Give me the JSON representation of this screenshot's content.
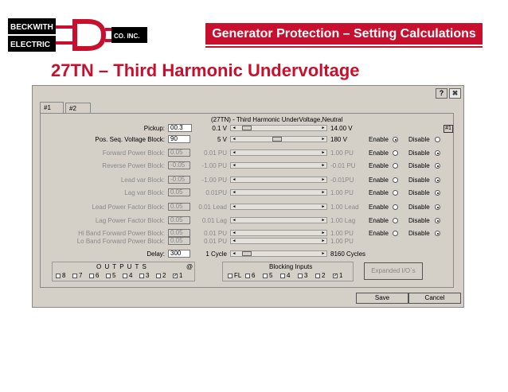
{
  "slide": {
    "logo": {
      "line1": "BECKWITH",
      "line2": "ELECTRIC",
      "suffix": "CO. INC."
    },
    "banner": "Generator Protection – Setting Calculations",
    "title": "27TN – Third Harmonic Undervoltage"
  },
  "window": {
    "help_label": "?",
    "close_label": "✖",
    "tabs": [
      "#1",
      "#2"
    ],
    "heading": "(27TN) - Third Harmonic UnderVoltage,Neutral",
    "badge": "#1",
    "enable_label": "Enable",
    "disable_label": "Disable",
    "rows": [
      {
        "label": "Pickup:",
        "value": "00.3",
        "min": "0.1 V",
        "max": "14.00 V",
        "enabled": true,
        "has_radio": false
      },
      {
        "label": "Pos. Seq. Voltage Block:",
        "value": "90",
        "min": "5 V",
        "max": "180 V",
        "enabled": true,
        "has_radio": true,
        "radio": "enable"
      },
      {
        "label": "Forward Power Block:",
        "value": "0.05",
        "min": "0.01 PU",
        "max": "1.00 PU",
        "enabled": false,
        "has_radio": true,
        "radio": "disable"
      },
      {
        "label": "Reverse Power Block:",
        "value": "-0.05",
        "min": "-1.00 PU",
        "max": "-0.01 PU",
        "enabled": false,
        "has_radio": true,
        "radio": "disable"
      },
      {
        "label": "Lead var Block:",
        "value": "-0.05",
        "min": "-1.00 PU",
        "max": "-0.01PU",
        "enabled": false,
        "has_radio": true,
        "radio": "disable"
      },
      {
        "label": "Lag var Block:",
        "value": "0.05",
        "min": "0.01PU",
        "max": "1.00 PU",
        "enabled": false,
        "has_radio": true,
        "radio": "disable"
      },
      {
        "label": "Lead Power Factor Block:",
        "value": "0.05",
        "min": "0.01 Lead",
        "max": "1.00 Lead",
        "enabled": false,
        "has_radio": true,
        "radio": "disable"
      },
      {
        "label": "Lag Power Factor Block:",
        "value": "0.05",
        "min": "0.01 Lag",
        "max": "1.00 Lag",
        "enabled": false,
        "has_radio": true,
        "radio": "disable"
      },
      {
        "label": "Hi Band Forward Power Block:",
        "value": "0.05",
        "min": "0.01 PU",
        "max": "1.00 PU",
        "enabled": false,
        "has_radio": true,
        "radio": "disable"
      },
      {
        "label": "Lo Band Forward Power Block:",
        "value": "0.05",
        "min": "0.01 PU",
        "max": "1.00 PU",
        "enabled": false,
        "has_radio": false
      },
      {
        "label": "Delay:",
        "value": "300",
        "min": "1 Cycle",
        "max": "8160 Cycles",
        "enabled": true,
        "has_radio": false
      }
    ],
    "outputs": {
      "title": "O U T P U T S",
      "suffix": "@",
      "items": [
        "8",
        "7",
        "6",
        "5",
        "4",
        "3",
        "2",
        "1"
      ],
      "checked": [
        "1"
      ]
    },
    "blocking": {
      "title": "Blocking Inputs",
      "items": [
        "FL",
        "6",
        "5",
        "4",
        "3",
        "2",
        "1"
      ],
      "checked": [
        "1"
      ]
    },
    "expanded_label": "Expanded I/O`s",
    "save_label": "Save",
    "cancel_label": "Cancel"
  },
  "colors": {
    "brand_red": "#c8102e",
    "dialog_grey": "#d4d0c8",
    "disabled_text": "#8a8a8a"
  }
}
